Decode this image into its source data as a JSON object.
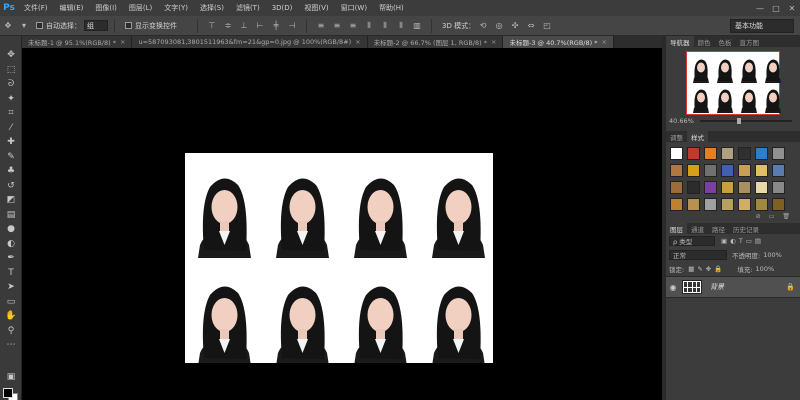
{
  "app": {
    "logo": "Ps"
  },
  "menu": [
    "文件(F)",
    "编辑(E)",
    "图像(I)",
    "图层(L)",
    "文字(Y)",
    "选择(S)",
    "滤镜(T)",
    "3D(D)",
    "视图(V)",
    "窗口(W)",
    "帮助(H)"
  ],
  "window_controls": [
    "—",
    "□",
    "✕"
  ],
  "options": {
    "auto_select_label": "自动选择：",
    "auto_select_value": "组",
    "show_transform_label": "显示变换控件",
    "mode3d_label": "3D 模式：",
    "workspace": "基本功能"
  },
  "tabs": [
    {
      "label": "未标题-1 @ 95.1%(RGB/8) *",
      "active": false
    },
    {
      "label": "u=587093081,3801511963&fm=21&gp=0.jpg @ 100%(RGB/8#)",
      "active": false
    },
    {
      "label": "未标题-2 @ 66.7% (图层 1, RGB/8) *",
      "active": false
    },
    {
      "label": "未标题-3 @ 40.7%(RGB/8) *",
      "active": true
    }
  ],
  "tab_close": "×",
  "navigator": {
    "tabs": [
      "导航器",
      "颜色",
      "色板",
      "直方图"
    ],
    "zoom": "40.66%"
  },
  "styles_panel": {
    "tabs": [
      "调整",
      "样式"
    ],
    "swatches": [
      "#ffffff",
      "#c0392b",
      "#e67e22",
      "#b0a080",
      "#303030",
      "#2a7fcf",
      "#909090",
      "#b07840",
      "#d4a017",
      "#707070",
      "#4060b0",
      "#c8a050",
      "#e0c060",
      "#5a7ab0",
      "#9e6b3a",
      "#2c2c2c",
      "#7a3fa0",
      "#c8a040",
      "#a89060",
      "#e8d8a8",
      "#888888",
      "#c08030",
      "#b89050",
      "#a0a0a0",
      "#b8a060",
      "#d0b060",
      "#a08840",
      "#806020"
    ]
  },
  "layers_panel": {
    "tabs": [
      "图层",
      "通道",
      "路径",
      "历史记录"
    ],
    "filter_type": "ρ 类型",
    "blend_mode": "正常",
    "opacity_label": "不透明度:",
    "opacity_value": "100%",
    "lock_label": "锁定:",
    "fill_label": "填充:",
    "fill_value": "100%",
    "layer_name": "背景"
  }
}
